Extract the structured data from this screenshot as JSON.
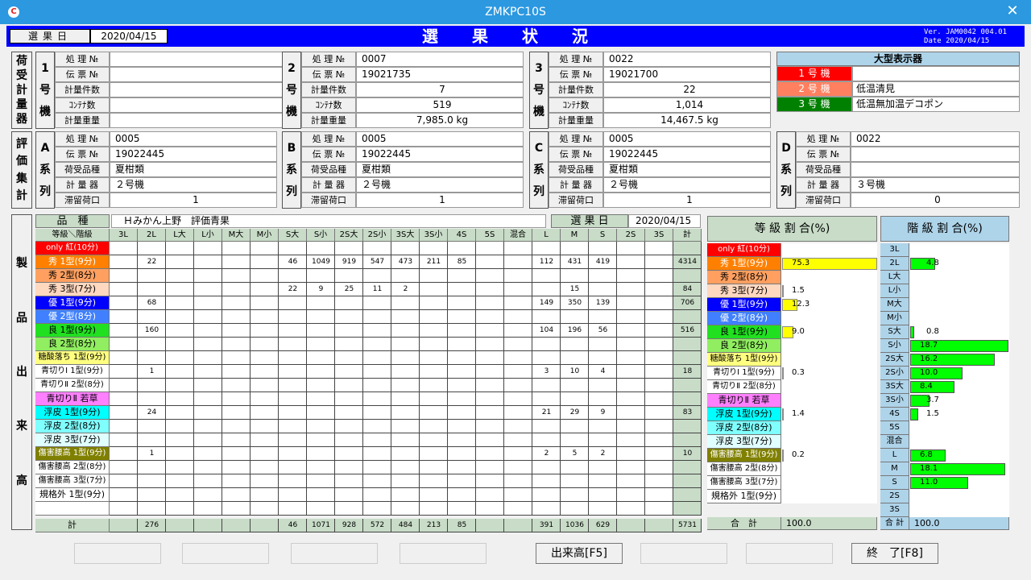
{
  "window": {
    "title": "ZMKPC10S",
    "app_icon": "C",
    "close": "✕"
  },
  "header": {
    "title": "選果状況",
    "select_date_label": "選果日",
    "select_date": "2020/04/15",
    "version": "Ver. JAM0042 004.01",
    "version_date": "Date 2020/04/15"
  },
  "colors": {
    "blue": "#0000ff",
    "green_head": "#c8dcc8",
    "bar_yellow": "#ffff00",
    "bar_green": "#00ff00"
  },
  "receiving": {
    "side_label": [
      "荷",
      "受",
      "計",
      "量",
      "器"
    ],
    "field_labels": [
      "処 理 №",
      "伝 票 №",
      "計量件数",
      "ｺﾝﾃﾅ数",
      "計量重量"
    ],
    "machines": [
      {
        "label": [
          "1",
          "号",
          "機"
        ],
        "values": [
          "",
          "",
          "",
          "",
          ""
        ]
      },
      {
        "label": [
          "2",
          "号",
          "機"
        ],
        "values": [
          "0007",
          "19021735",
          "7",
          "519",
          "7,985.0  kg"
        ]
      },
      {
        "label": [
          "3",
          "号",
          "機"
        ],
        "values": [
          "0022",
          "19021700",
          "22",
          "1,014",
          "14,467.5  kg"
        ]
      }
    ]
  },
  "big_display": {
    "title": "大型表示器",
    "rows": [
      {
        "label": "1 号 機",
        "value": "",
        "color": "#ff0000"
      },
      {
        "label": "2 号 機",
        "value": "低温清見",
        "color": "#ff8060"
      },
      {
        "label": "3 号 機",
        "value": "低温無加温デコポン",
        "color": "#008000"
      }
    ]
  },
  "evaluation": {
    "side_label": [
      "評",
      "価",
      "集",
      "計"
    ],
    "field_labels": [
      "処 理 №",
      "伝 票 №",
      "荷受品種",
      "計 量 器",
      "滞留荷口"
    ],
    "series": [
      {
        "label": [
          "A",
          "系",
          "列"
        ],
        "values": [
          "0005",
          "19022445",
          "夏柑類",
          "２号機",
          "1"
        ]
      },
      {
        "label": [
          "B",
          "系",
          "列"
        ],
        "values": [
          "0005",
          "19022445",
          "夏柑類",
          "２号機",
          "1"
        ]
      },
      {
        "label": [
          "C",
          "系",
          "列"
        ],
        "values": [
          "0005",
          "19022445",
          "夏柑類",
          "２号機",
          "1"
        ]
      },
      {
        "label": [
          "D",
          "系",
          "列"
        ],
        "values": [
          "0022",
          "",
          "",
          "３号機",
          "0"
        ]
      }
    ]
  },
  "production": {
    "side_label": [
      "製",
      "品",
      "出",
      "来",
      "高"
    ],
    "variety_label": "品　種",
    "variety": "Ｈみかん上野　評価青果",
    "date_label": "選 果 日",
    "date": "2020/04/15",
    "corner": "等級＼階級",
    "columns": [
      "3L",
      "2L",
      "L大",
      "L小",
      "M大",
      "M小",
      "S大",
      "S小",
      "2S大",
      "2S小",
      "3S大",
      "3S小",
      "4S",
      "5S",
      "混合",
      "L",
      "M",
      "S",
      "2S",
      "3S",
      "計"
    ],
    "rows": [
      {
        "label": "only 紅(10分)",
        "bg": "#ff0000",
        "fg": "#ffffff",
        "cells": [
          "",
          "",
          "",
          "",
          "",
          "",
          "",
          "",
          "",
          "",
          "",
          "",
          "",
          "",
          "",
          "",
          "",
          "",
          "",
          "",
          ""
        ]
      },
      {
        "label": "秀 1型(9分)",
        "bg": "#ff8000",
        "fg": "#ffffff",
        "cells": [
          "",
          "22",
          "",
          "",
          "",
          "",
          "46",
          "1049",
          "919",
          "547",
          "473",
          "211",
          "85",
          "",
          "",
          "112",
          "431",
          "419",
          "",
          "",
          "4314"
        ]
      },
      {
        "label": "秀 2型(8分)",
        "bg": "#ffa060",
        "fg": "#000000",
        "cells": [
          "",
          "",
          "",
          "",
          "",
          "",
          "",
          "",
          "",
          "",
          "",
          "",
          "",
          "",
          "",
          "",
          "",
          "",
          "",
          "",
          ""
        ]
      },
      {
        "label": "秀 3型(7分)",
        "bg": "#ffd8c0",
        "fg": "#000000",
        "cells": [
          "",
          "",
          "",
          "",
          "",
          "",
          "22",
          "9",
          "25",
          "11",
          "2",
          "",
          "",
          "",
          "",
          "",
          "15",
          "",
          "",
          "",
          "84"
        ]
      },
      {
        "label": "優 1型(9分)",
        "bg": "#0000ff",
        "fg": "#ffffff",
        "cells": [
          "",
          "68",
          "",
          "",
          "",
          "",
          "",
          "",
          "",
          "",
          "",
          "",
          "",
          "",
          "",
          "149",
          "350",
          "139",
          "",
          "",
          "706"
        ]
      },
      {
        "label": "優 2型(8分)",
        "bg": "#4080ff",
        "fg": "#ffffff",
        "cells": [
          "",
          "",
          "",
          "",
          "",
          "",
          "",
          "",
          "",
          "",
          "",
          "",
          "",
          "",
          "",
          "",
          "",
          "",
          "",
          "",
          ""
        ]
      },
      {
        "label": "良 1型(9分)",
        "bg": "#20e020",
        "fg": "#000000",
        "cells": [
          "",
          "160",
          "",
          "",
          "",
          "",
          "",
          "",
          "",
          "",
          "",
          "",
          "",
          "",
          "",
          "104",
          "196",
          "56",
          "",
          "",
          "516"
        ]
      },
      {
        "label": "良 2型(8分)",
        "bg": "#90ee60",
        "fg": "#000000",
        "cells": [
          "",
          "",
          "",
          "",
          "",
          "",
          "",
          "",
          "",
          "",
          "",
          "",
          "",
          "",
          "",
          "",
          "",
          "",
          "",
          "",
          ""
        ]
      },
      {
        "label": "糖酸落ち 1型(9分)",
        "bg": "#ffff80",
        "fg": "#000000",
        "cells": [
          "",
          "",
          "",
          "",
          "",
          "",
          "",
          "",
          "",
          "",
          "",
          "",
          "",
          "",
          "",
          "",
          "",
          "",
          "",
          "",
          ""
        ]
      },
      {
        "label": "青切りⅠ 1型(9分)",
        "bg": "#ffffff",
        "fg": "#000000",
        "cells": [
          "",
          "1",
          "",
          "",
          "",
          "",
          "",
          "",
          "",
          "",
          "",
          "",
          "",
          "",
          "",
          "3",
          "10",
          "4",
          "",
          "",
          "18"
        ]
      },
      {
        "label": "青切りⅡ 2型(8分)",
        "bg": "#ffffff",
        "fg": "#000000",
        "cells": [
          "",
          "",
          "",
          "",
          "",
          "",
          "",
          "",
          "",
          "",
          "",
          "",
          "",
          "",
          "",
          "",
          "",
          "",
          "",
          "",
          ""
        ]
      },
      {
        "label": "青切りⅡ 若草",
        "bg": "#ff80ff",
        "fg": "#000000",
        "cells": [
          "",
          "",
          "",
          "",
          "",
          "",
          "",
          "",
          "",
          "",
          "",
          "",
          "",
          "",
          "",
          "",
          "",
          "",
          "",
          "",
          ""
        ]
      },
      {
        "label": "浮皮 1型(9分)",
        "bg": "#00ffff",
        "fg": "#000000",
        "cells": [
          "",
          "24",
          "",
          "",
          "",
          "",
          "",
          "",
          "",
          "",
          "",
          "",
          "",
          "",
          "",
          "21",
          "29",
          "9",
          "",
          "",
          "83"
        ]
      },
      {
        "label": "浮皮 2型(8分)",
        "bg": "#80ffff",
        "fg": "#000000",
        "cells": [
          "",
          "",
          "",
          "",
          "",
          "",
          "",
          "",
          "",
          "",
          "",
          "",
          "",
          "",
          "",
          "",
          "",
          "",
          "",
          "",
          ""
        ]
      },
      {
        "label": "浮皮 3型(7分)",
        "bg": "#e0ffff",
        "fg": "#000000",
        "cells": [
          "",
          "",
          "",
          "",
          "",
          "",
          "",
          "",
          "",
          "",
          "",
          "",
          "",
          "",
          "",
          "",
          "",
          "",
          "",
          "",
          ""
        ]
      },
      {
        "label": "傷害腰高 1型(9分)",
        "bg": "#808000",
        "fg": "#ffffff",
        "cells": [
          "",
          "1",
          "",
          "",
          "",
          "",
          "",
          "",
          "",
          "",
          "",
          "",
          "",
          "",
          "",
          "2",
          "5",
          "2",
          "",
          "",
          "10"
        ]
      },
      {
        "label": "傷害腰高 2型(8分)",
        "bg": "#ffffff",
        "fg": "#000000",
        "cells": [
          "",
          "",
          "",
          "",
          "",
          "",
          "",
          "",
          "",
          "",
          "",
          "",
          "",
          "",
          "",
          "",
          "",
          "",
          "",
          "",
          ""
        ]
      },
      {
        "label": "傷害腰高 3型(7分)",
        "bg": "#ffffff",
        "fg": "#000000",
        "cells": [
          "",
          "",
          "",
          "",
          "",
          "",
          "",
          "",
          "",
          "",
          "",
          "",
          "",
          "",
          "",
          "",
          "",
          "",
          "",
          "",
          ""
        ]
      },
      {
        "label": "規格外 1型(9分)",
        "bg": "#ffffff",
        "fg": "#000000",
        "cells": [
          "",
          "",
          "",
          "",
          "",
          "",
          "",
          "",
          "",
          "",
          "",
          "",
          "",
          "",
          "",
          "",
          "",
          "",
          "",
          "",
          ""
        ]
      },
      {
        "label": "",
        "bg": "#ffffff",
        "fg": "#000000",
        "cells": [
          "",
          "",
          "",
          "",
          "",
          "",
          "",
          "",
          "",
          "",
          "",
          "",
          "",
          "",
          "",
          "",
          "",
          "",
          "",
          "",
          ""
        ]
      }
    ],
    "total_label": "計",
    "totals": [
      "",
      "276",
      "",
      "",
      "",
      "",
      "46",
      "1071",
      "928",
      "572",
      "484",
      "213",
      "85",
      "",
      "",
      "391",
      "1036",
      "629",
      "",
      "",
      "5731"
    ]
  },
  "grade_ratio": {
    "title": "等 級 割 合(%)",
    "total_label": "合　計",
    "total": "100.0",
    "values": [
      "",
      "75.3",
      "",
      "1.5",
      "12.3",
      "",
      "9.0",
      "",
      "",
      "0.3",
      "",
      "",
      "1.4",
      "",
      "",
      "0.2",
      "",
      "",
      "",
      ""
    ],
    "fractions": [
      0,
      0.753,
      0,
      0.015,
      0.123,
      0,
      0.09,
      0,
      0,
      0.003,
      0,
      0,
      0.014,
      0,
      0,
      0.002,
      0,
      0,
      0,
      0
    ]
  },
  "class_ratio": {
    "title": "階 級 割 合(%)",
    "total_label": "合 計",
    "total": "100.0",
    "labels": [
      "3L",
      "2L",
      "L大",
      "L小",
      "M大",
      "M小",
      "S大",
      "S小",
      "2S大",
      "2S小",
      "3S大",
      "3S小",
      "4S",
      "5S",
      "混合",
      "L",
      "M",
      "S",
      "2S",
      "3S"
    ],
    "values": [
      "",
      "4.8",
      "",
      "",
      "",
      "",
      "0.8",
      "18.7",
      "16.2",
      "10.0",
      "8.4",
      "3.7",
      "1.5",
      "",
      "",
      "6.8",
      "18.1",
      "11.0",
      "",
      ""
    ],
    "fractions": [
      0,
      0.048,
      0,
      0,
      0,
      0,
      0.008,
      0.187,
      0.162,
      0.1,
      0.084,
      0.037,
      0.015,
      0,
      0,
      0.068,
      0.181,
      0.11,
      0,
      0
    ]
  },
  "buttons": {
    "production": "出来高[F5]",
    "exit": "終　了[F8]"
  }
}
